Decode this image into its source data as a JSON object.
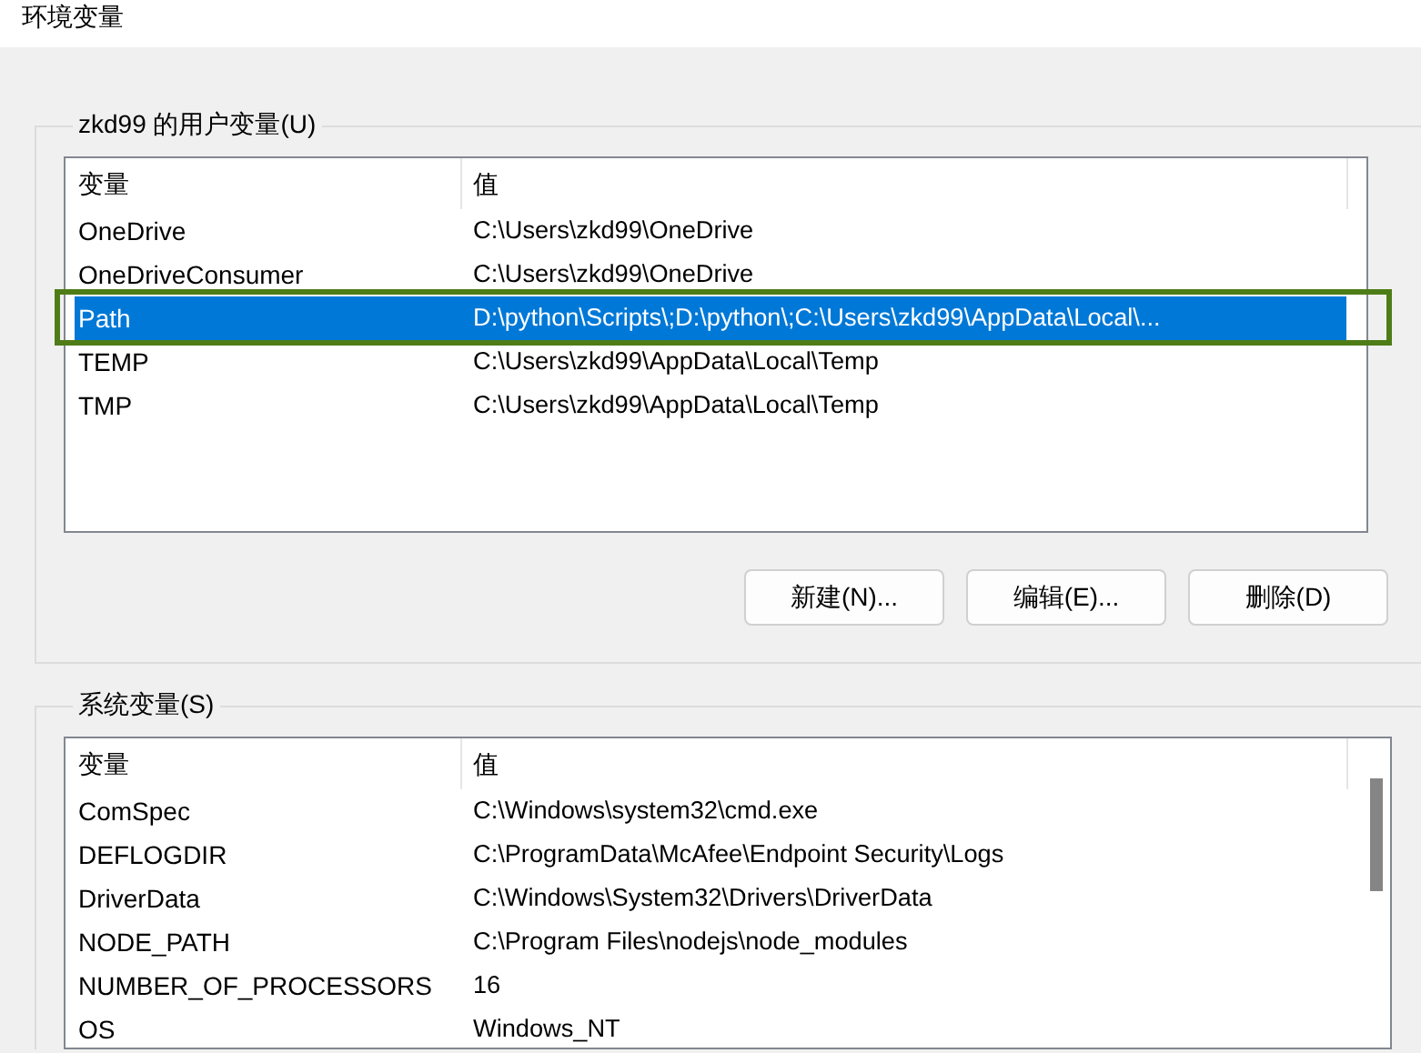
{
  "window": {
    "title": "环境变量"
  },
  "user_variables": {
    "title": "zkd99 的用户变量(U)",
    "columns": [
      "变量",
      "值"
    ],
    "rows": [
      {
        "name": "OneDrive",
        "value": "C:\\Users\\zkd99\\OneDrive",
        "selected": false,
        "highlighted": false
      },
      {
        "name": "OneDriveConsumer",
        "value": "C:\\Users\\zkd99\\OneDrive",
        "selected": false,
        "highlighted": false
      },
      {
        "name": "Path",
        "value": "D:\\python\\Scripts\\;D:\\python\\;C:\\Users\\zkd99\\AppData\\Local\\...",
        "selected": true,
        "highlighted": true
      },
      {
        "name": "TEMP",
        "value": "C:\\Users\\zkd99\\AppData\\Local\\Temp",
        "selected": false,
        "highlighted": false
      },
      {
        "name": "TMP",
        "value": "C:\\Users\\zkd99\\AppData\\Local\\Temp",
        "selected": false,
        "highlighted": false
      }
    ],
    "buttons": [
      "新建(N)...",
      "编辑(E)...",
      "删除(D)"
    ]
  },
  "system_variables": {
    "title": "系统变量(S)",
    "columns": [
      "变量",
      "值"
    ],
    "rows": [
      {
        "name": "ComSpec",
        "value": "C:\\Windows\\system32\\cmd.exe",
        "selected": false,
        "highlighted": false
      },
      {
        "name": "DEFLOGDIR",
        "value": "C:\\ProgramData\\McAfee\\Endpoint Security\\Logs",
        "selected": false,
        "highlighted": false
      },
      {
        "name": "DriverData",
        "value": "C:\\Windows\\System32\\Drivers\\DriverData",
        "selected": false,
        "highlighted": false
      },
      {
        "name": "NODE_PATH",
        "value": "C:\\Program Files\\nodejs\\node_modules",
        "selected": false,
        "highlighted": false
      },
      {
        "name": "NUMBER_OF_PROCESSORS",
        "value": "16",
        "selected": false,
        "highlighted": false
      },
      {
        "name": "OS",
        "value": "Windows_NT",
        "selected": false,
        "highlighted": false
      }
    ]
  }
}
